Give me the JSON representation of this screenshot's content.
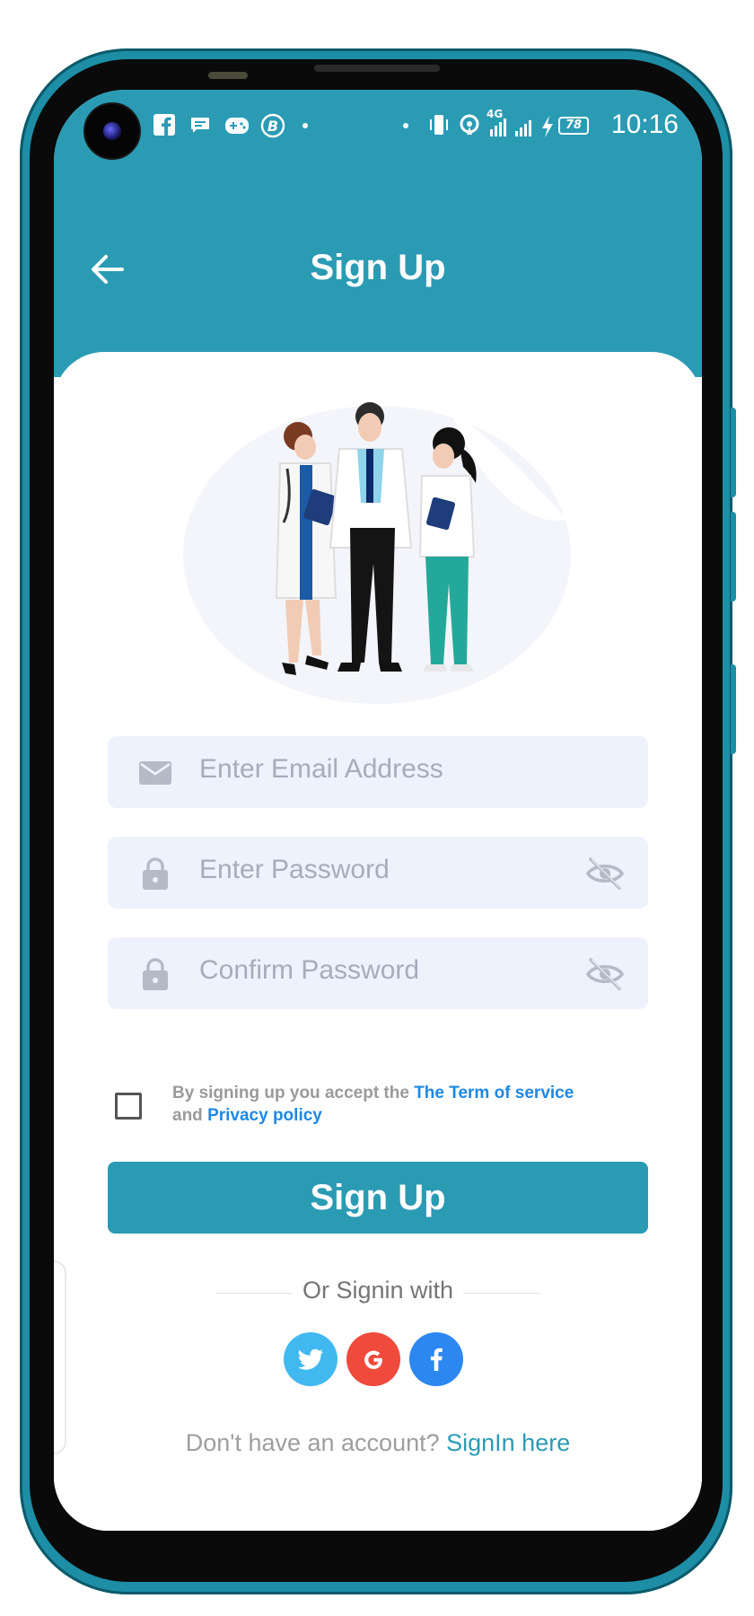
{
  "status_bar": {
    "time": "10:16",
    "battery": "78",
    "network": "4G",
    "icons": [
      "facebook-icon",
      "message-icon",
      "gamepad-icon",
      "b-circle-icon",
      "dot-icon",
      "vibrate-icon",
      "hotspot-icon",
      "signal-icon",
      "charging-icon",
      "battery-icon"
    ]
  },
  "appbar": {
    "title": "Sign Up",
    "back_icon": "arrow-left-icon"
  },
  "form": {
    "email_placeholder": "Enter Email Address",
    "password_placeholder": "Enter Password",
    "confirm_placeholder": "Confirm Password"
  },
  "terms": {
    "prefix": "By signing up you accept the ",
    "terms_link": "The Term of service",
    "and": "and ",
    "privacy_link": "Privacy policy",
    "checked": false
  },
  "signup_button": "Sign Up",
  "social": {
    "label": "Or Signin with",
    "providers": [
      {
        "name": "twitter",
        "color": "#42b8f0"
      },
      {
        "name": "google",
        "color": "#ef4a3c"
      },
      {
        "name": "facebook",
        "color": "#2d87f0"
      }
    ]
  },
  "footer": {
    "question": "Don't have an account? ",
    "link": "SignIn here"
  },
  "colors": {
    "primary": "#2b9bb4",
    "field_bg": "#eef2fc",
    "link_blue": "#1e88e5"
  }
}
